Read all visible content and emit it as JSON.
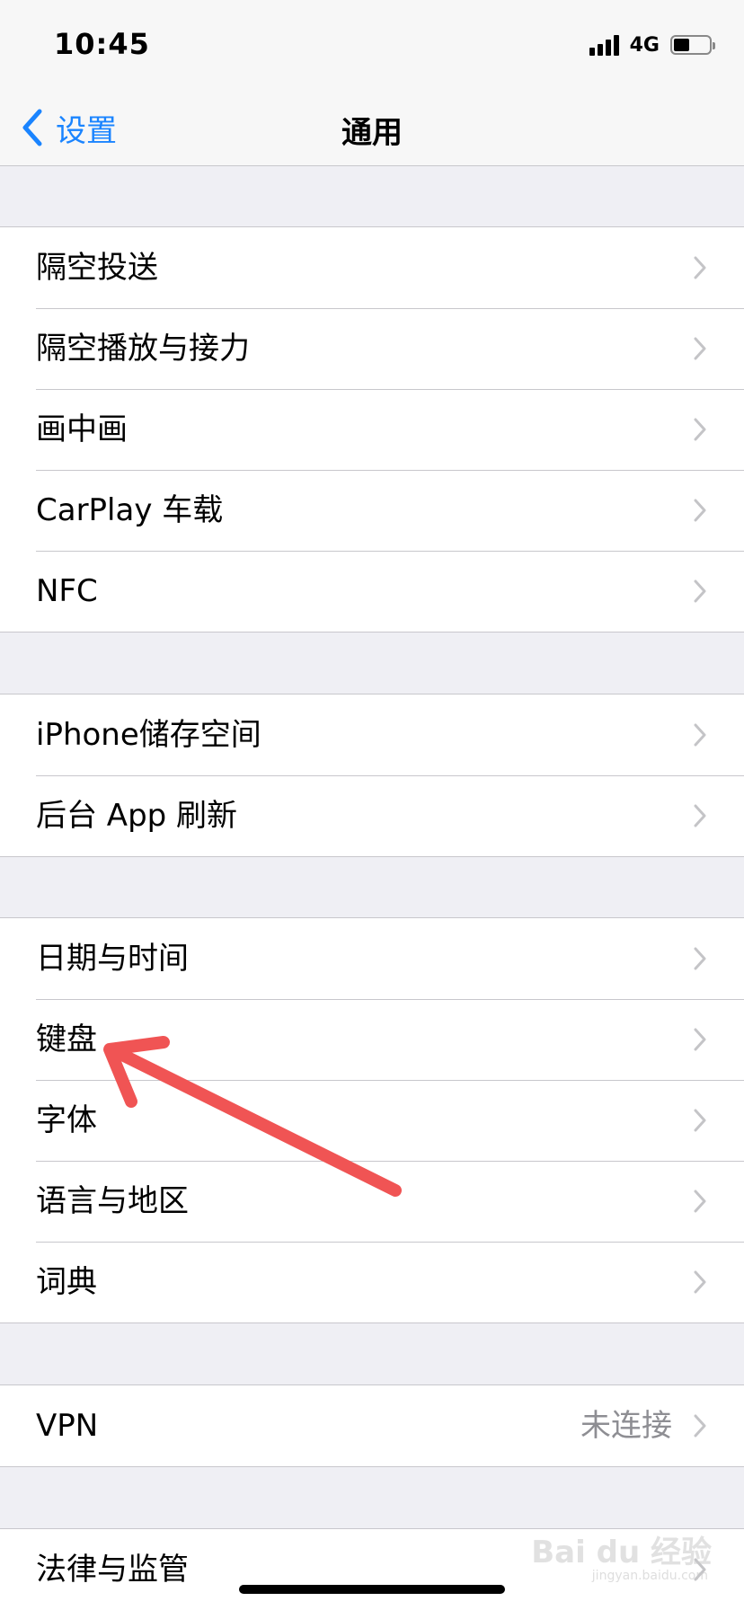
{
  "status_bar": {
    "time": "10:45",
    "network": "4G",
    "battery_level": 0.45
  },
  "navbar": {
    "back_label": "设置",
    "title": "通用"
  },
  "groups": [
    {
      "items": [
        {
          "label": "隔空投送"
        },
        {
          "label": "隔空播放与接力"
        },
        {
          "label": "画中画"
        },
        {
          "label": "CarPlay 车载"
        },
        {
          "label": "NFC"
        }
      ]
    },
    {
      "items": [
        {
          "label": "iPhone储存空间"
        },
        {
          "label": "后台 App 刷新"
        }
      ]
    },
    {
      "items": [
        {
          "label": "日期与时间"
        },
        {
          "label": "键盘"
        },
        {
          "label": "字体"
        },
        {
          "label": "语言与地区"
        },
        {
          "label": "词典"
        }
      ]
    },
    {
      "items": [
        {
          "label": "VPN",
          "detail": "未连接"
        }
      ]
    },
    {
      "items": [
        {
          "label": "法律与监管"
        }
      ]
    }
  ],
  "watermark": {
    "text": "Bai du 经验",
    "sub": "jingyan.baidu.com"
  },
  "colors": {
    "accent": "#1a84ff",
    "annotation_arrow": "#f05454",
    "background": "#efeff4"
  }
}
